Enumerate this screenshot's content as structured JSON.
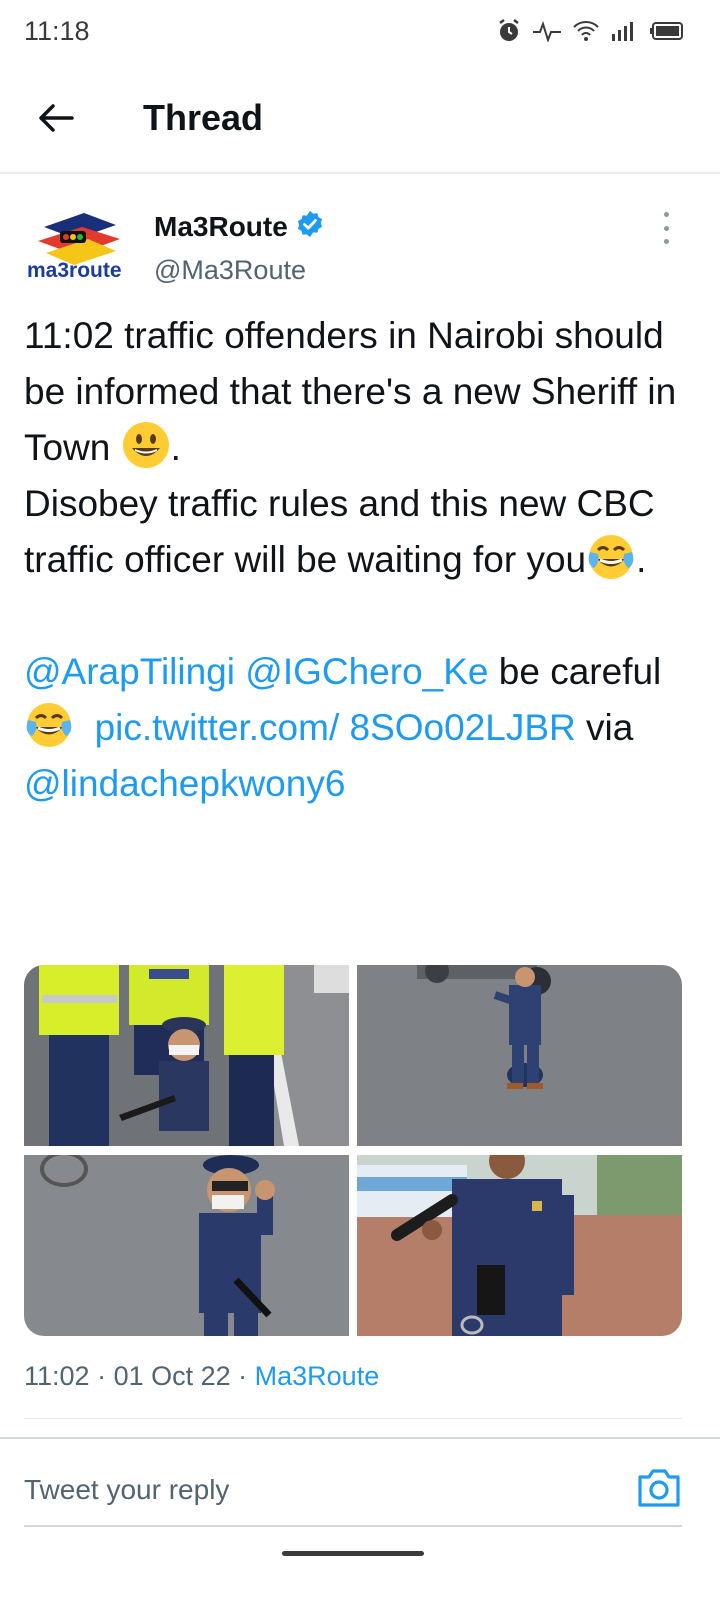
{
  "status_bar": {
    "time": "11:18",
    "icons": [
      "alarm-icon",
      "activity-icon",
      "wifi-icon",
      "signal-icon",
      "battery-icon"
    ]
  },
  "header": {
    "back_icon": "arrow-left-icon",
    "title": "Thread"
  },
  "tweet": {
    "avatar_text": "ma3route",
    "display_name": "Ma3Route",
    "verified": true,
    "handle": "@Ma3Route",
    "text": {
      "line1": "11:02 traffic offenders in Nairobi should be informed that there's a new Sheriff in Town ",
      "line1_end": ".",
      "line2": "Disobey traffic rules and this new CBC traffic officer will be waiting for you",
      "line2_end": ".",
      "mention1": "@ArapTilingi",
      "mention2": "@IGChero_Ke",
      "be": " be careful ",
      "pic_link": "pic.twitter.com/ 8SOo02LJBR",
      "via": " via ",
      "mention3": "@lindachepkwony6"
    },
    "emojis": [
      "grinning-face-emoji",
      "tears-of-joy-emoji",
      "tears-of-joy-emoji"
    ],
    "media": [
      {
        "name": "photo-child-with-police-officers"
      },
      {
        "name": "photo-child-on-road"
      },
      {
        "name": "photo-child-raising-hand"
      },
      {
        "name": "photo-child-with-baton"
      }
    ],
    "time": "11:02",
    "separator": " · ",
    "date": "01 Oct 22",
    "source": "Ma3Route"
  },
  "reply": {
    "placeholder": "Tweet your reply",
    "camera_icon": "camera-icon"
  },
  "colors": {
    "link": "#1d9bf0",
    "text": "#0f1419",
    "secondary": "#536471",
    "divider": "#cfd9de"
  }
}
